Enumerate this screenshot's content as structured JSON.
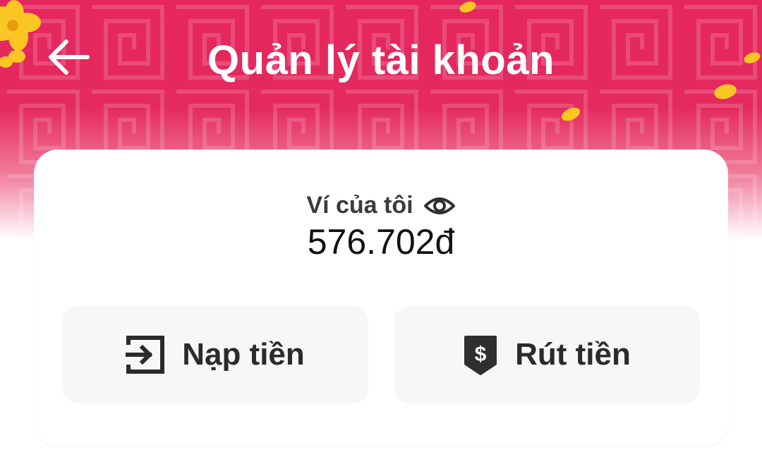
{
  "header": {
    "title": "Quản lý tài khoản",
    "back_icon": "arrow-left-icon",
    "brand_color": "#e5275f"
  },
  "wallet": {
    "label": "Ví của tôi",
    "visibility_icon": "eye-icon",
    "balance": "576.702đ"
  },
  "actions": [
    {
      "label": "Nạp tiền",
      "icon": "login-arrow-icon"
    },
    {
      "label": "Rút tiền",
      "icon": "dollar-shield-icon"
    }
  ]
}
